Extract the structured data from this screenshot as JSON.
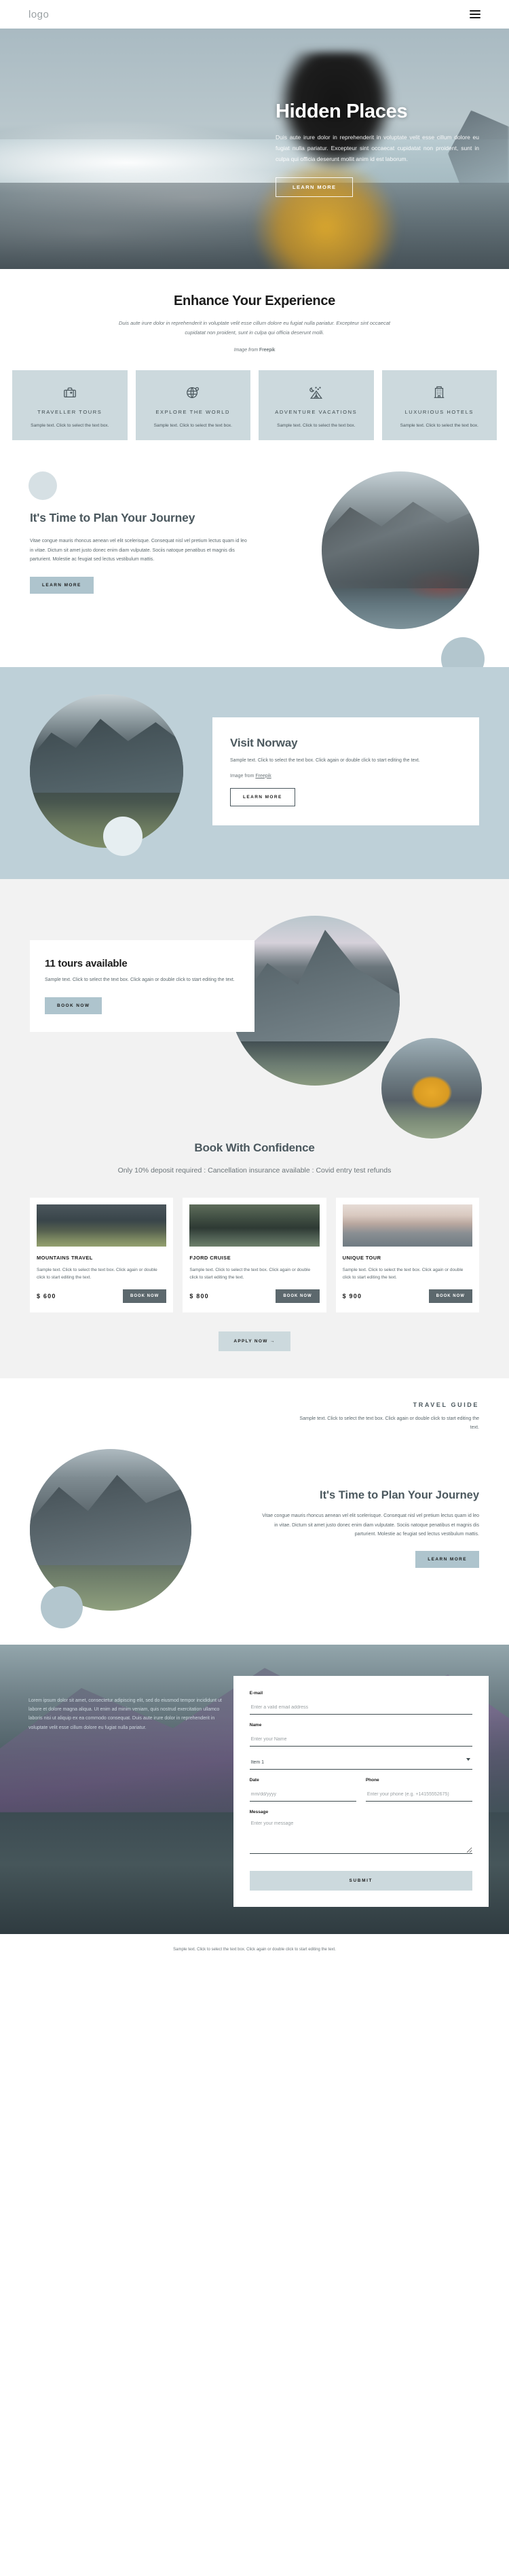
{
  "header": {
    "logo": "logo",
    "menu_label": "menu"
  },
  "hero": {
    "title": "Hidden Places",
    "paragraph": "Duis aute irure dolor in reprehenderit in voluptate velit esse cillum dolore eu fugiat nulla pariatur. Excepteur sint occaecat cupidatat non proident, sunt in culpa qui officia deserunt mollit anim id est laborum.",
    "cta": "LEARN MORE"
  },
  "enhance": {
    "title": "Enhance Your Experience",
    "lede": "Duis aute irure dolor in reprehenderit in voluptate velit esse cillum dolore eu fugiat nulla pariatur. Excepteur sint occaecat cupidatat non proident, sunt in culpa qui officia deserunt molli.",
    "credit_prefix": "Image from ",
    "credit_source": "Freepik"
  },
  "features": [
    {
      "icon": "suitcase-icon",
      "title": "TRAVELLER TOURS",
      "text": "Sample text. Click to select the text box."
    },
    {
      "icon": "globe-pin-icon",
      "title": "EXPLORE THE WORLD",
      "text": "Sample text. Click to select the text box."
    },
    {
      "icon": "tent-night-icon",
      "title": "ADVENTURE VACATIONS",
      "text": "Sample text. Click to select the text box."
    },
    {
      "icon": "hotel-building-icon",
      "title": "LUXURIOUS HOTELS",
      "text": "Sample text. Click to select the text box."
    }
  ],
  "plan": {
    "title": "It's Time to Plan Your Journey",
    "paragraph": "Vitae congue mauris rhoncus aenean vel elit scelerisque. Consequat nisl vel pretium lectus quam id leo in vitae. Dictum sit amet justo donec enim diam vulputate. Sociis natoque penatibus et magnis dis parturient. Molestie ac feugiat sed lectus vestibulum mattis.",
    "cta": "LEARN MORE"
  },
  "norway": {
    "title": "Visit Norway",
    "paragraph": "Sample text. Click to select the text box. Click again or double click to start editing the text.",
    "credit_prefix": "Image from ",
    "credit_source": "Freepik",
    "cta": "LEARN MORE"
  },
  "tours": {
    "title": "11 tours available",
    "paragraph": "Sample text. Click to select the text box. Click again or double click to start editing the text.",
    "cta": "BOOK NOW"
  },
  "book": {
    "title": "Book With Confidence",
    "subtitle": "Only 10% deposit required : Cancellation insurance available : Covid entry test refunds",
    "apply_cta": "APPLY NOW  →",
    "cards": [
      {
        "thumb": "thumb-mountains",
        "title": "MOUNTAINS TRAVEL",
        "text": "Sample text. Click to select the text box. Click again or double click to start editing the text.",
        "price": "$ 600",
        "cta": "BOOK NOW"
      },
      {
        "thumb": "thumb-fjord",
        "title": "FJORD CRUISE",
        "text": "Sample text. Click to select the text box. Click again or double click to start editing the text.",
        "price": "$ 800",
        "cta": "BOOK NOW"
      },
      {
        "thumb": "thumb-unique",
        "title": "UNIQUE TOUR",
        "text": "Sample text. Click to select the text box. Click again or double click to start editing the text.",
        "price": "$ 900",
        "cta": "BOOK NOW"
      }
    ]
  },
  "guide": {
    "eyebrow": "TRAVEL GUIDE",
    "paragraph": "Sample text. Click to select the text box. Click again or double click to start editing the text."
  },
  "plan2": {
    "title": "It's Time to Plan Your Journey",
    "paragraph": "Vitae congue mauris rhoncus aenean vel elit scelerisque. Consequat nisl vel pretium lectus quam id leo in vitae. Dictum sit amet justo donec enim diam vulputate. Sociis natoque penatibus et magnis dis parturient. Molestie ac feugiat sed lectus vestibulum mattis.",
    "cta": "LEARN MORE"
  },
  "contact": {
    "blurb": "Lorem ipsum dolor sit amet, consectetur adipiscing elit, sed do eiusmod tempor incididunt ut labore et dolore magna aliqua. Ut enim ad minim veniam, quis nostrud exercitation ullamco laboris nisi ut aliquip ex ea commodo consequat. Duis aute irure dolor in reprehenderit in voluptate velit esse cillum dolore eu fugiat nulla pariatur.",
    "email_label": "E-mail",
    "email_placeholder": "Enter a valid email address",
    "name_label": "Name",
    "name_placeholder": "Enter your Name",
    "select_value": "Item 1",
    "date_label": "Date",
    "date_placeholder": "mm/dd/yyyy",
    "phone_label": "Phone",
    "phone_placeholder": "Enter your phone (e.g. +14155552675)",
    "message_label": "Message",
    "message_placeholder": "Enter your message",
    "submit": "SUBMIT"
  },
  "footer": {
    "text": "Sample text. Click to select the text box. Click again or double click to start editing the text."
  },
  "colors": {
    "accent_light": "#ccd9dd",
    "accent": "#aec4cd",
    "panel": "#bed0d8",
    "dark": "#5c686d",
    "ink": "#1b1b1b"
  }
}
